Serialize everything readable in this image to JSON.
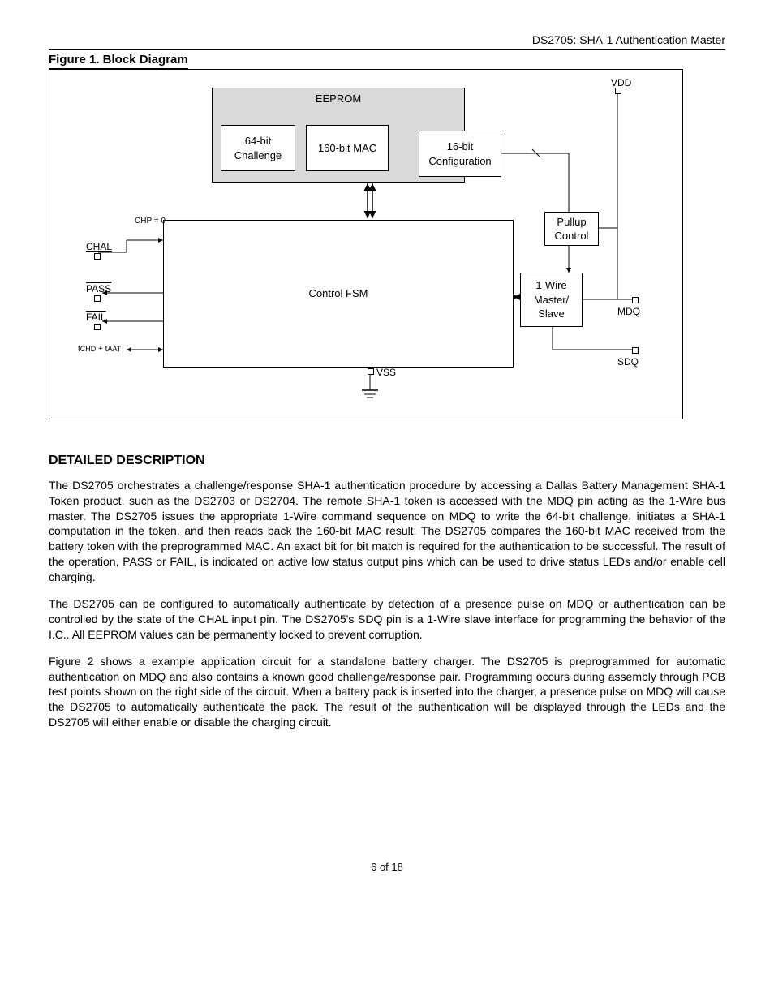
{
  "header": "DS2705: SHA-1 Authentication Master",
  "figure_title": "Figure 1. Block Diagram",
  "diagram": {
    "eeprom": "EEPROM",
    "challenge": "64-bit\nChallenge",
    "mac": "160-bit MAC",
    "config": "16-bit\nConfiguration",
    "fsm": "Control FSM",
    "onewire": "1-Wire\nMaster/\nSlave",
    "pullup": "Pullup\nControl",
    "chp": "CHP = 0",
    "pins": {
      "chal": "CHAL",
      "pass": "PASS",
      "fail": "FAIL",
      "timing": "tCHD + tAAT",
      "vdd": "VDD",
      "mdq": "MDQ",
      "sdq": "SDQ",
      "vss": "VSS"
    }
  },
  "section_title": "DETAILED DESCRIPTION",
  "para1": "The DS2705 orchestrates a challenge/response SHA-1 authentication procedure by accessing a Dallas Battery Management SHA-1 Token product, such as the DS2703 or DS2704. The remote SHA-1 token is accessed with the MDQ pin acting as the 1-Wire bus master. The DS2705 issues the appropriate 1-Wire command sequence on MDQ to write the 64-bit challenge, initiates a SHA-1 computation in the token, and then reads back the 160-bit MAC result. The DS2705 compares the 160-bit MAC received from the battery token with the preprogrammed MAC. An exact bit for bit match is required for the authentication to be successful. The result of the operation, PASS or FAIL, is indicated on active low status output pins which can be used to drive status LEDs and/or enable cell charging.",
  "para2": "The DS2705 can be configured to automatically authenticate by detection of a presence pulse on MDQ or authentication can be controlled by the state of the CHAL input pin. The DS2705's SDQ pin is a 1-Wire slave interface for programming the behavior of the I.C.. All EEPROM values can be permanently locked to prevent corruption.",
  "para3": "Figure 2 shows a example application circuit for a standalone battery charger. The DS2705 is preprogrammed for automatic authentication on MDQ and also contains a known good challenge/response pair. Programming occurs during assembly through PCB test points shown on the right side of the circuit. When a battery pack is inserted into the charger, a presence pulse on MDQ will cause the DS2705 to automatically authenticate the pack. The result of the authentication will be displayed through the LEDs and the DS2705 will either enable or disable the charging circuit.",
  "footer": "6 of 18"
}
